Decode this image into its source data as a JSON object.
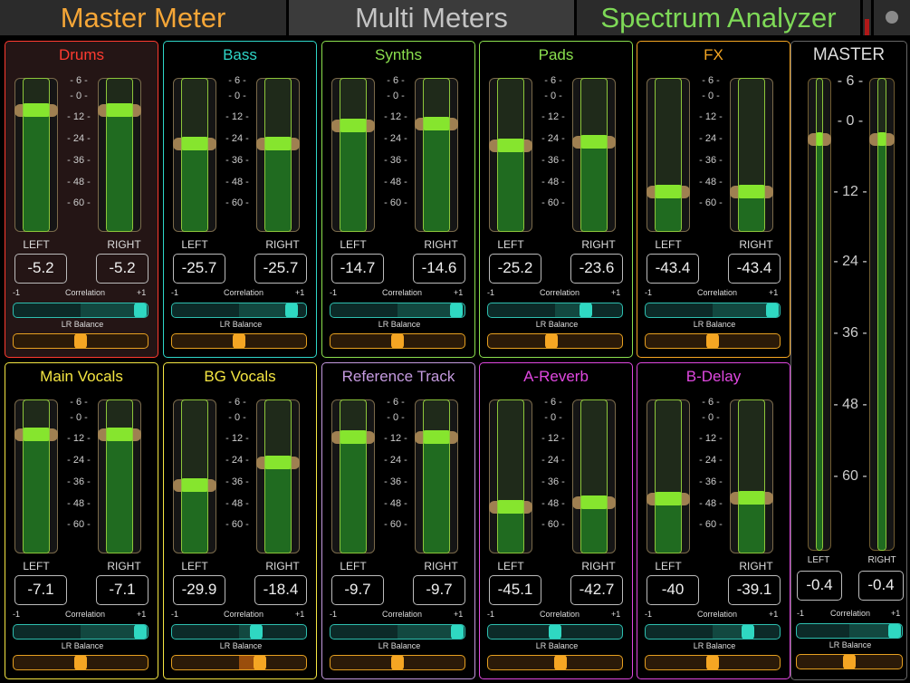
{
  "tabs": {
    "master": {
      "label": "Master Meter",
      "color": "#f5a637"
    },
    "multi": {
      "label": "Multi Meters",
      "color": "#c4c4c4"
    },
    "spectrum": {
      "label": "Spectrum Analyzer",
      "color": "#7ed957"
    }
  },
  "common": {
    "left_label": "LEFT",
    "right_label": "RIGHT",
    "correlation_label": "Correlation",
    "correlation_min": "-1",
    "correlation_max": "+1",
    "balance_label": "LR Balance"
  },
  "scale_ticks": [
    "- 6 -",
    "- 0 -",
    "- 12 -",
    "- 24 -",
    "- 36 -",
    "- 48 -",
    "- 60 -"
  ],
  "channels": [
    {
      "name": "Drums",
      "color": "#ff3b30",
      "bg": "#241515",
      "left_value": "-5.2",
      "right_value": "-5.2",
      "left_level": 0.82,
      "right_level": 0.82,
      "correlation": 1.0,
      "balance": 0.0
    },
    {
      "name": "Bass",
      "color": "#2ed6c8",
      "bg": "#000000",
      "left_value": "-25.7",
      "right_value": "-25.7",
      "left_level": 0.6,
      "right_level": 0.6,
      "correlation": 0.88,
      "balance": 0.0
    },
    {
      "name": "Synths",
      "color": "#8be04e",
      "bg": "#000000",
      "left_value": "-14.7",
      "right_value": "-14.6",
      "left_level": 0.72,
      "right_level": 0.73,
      "correlation": 0.98,
      "balance": 0.0
    },
    {
      "name": "Pads",
      "color": "#8be04e",
      "bg": "#000000",
      "left_value": "-25.2",
      "right_value": "-23.6",
      "left_level": 0.59,
      "right_level": 0.61,
      "correlation": 0.52,
      "balance": -0.05
    },
    {
      "name": "FX",
      "color": "#f5a623",
      "bg": "#000000",
      "left_value": "-43.4",
      "right_value": "-43.4",
      "left_level": 0.29,
      "right_level": 0.29,
      "correlation": 1.0,
      "balance": 0.0
    },
    {
      "name": "Main Vocals",
      "color": "#f5e642",
      "bg": "#000000",
      "left_value": "-7.1",
      "right_value": "-7.1",
      "left_level": 0.8,
      "right_level": 0.8,
      "correlation": 1.0,
      "balance": 0.0
    },
    {
      "name": "BG Vocals",
      "color": "#f5e642",
      "bg": "#000000",
      "left_value": "-29.9",
      "right_value": "-18.4",
      "left_level": 0.47,
      "right_level": 0.62,
      "correlation": 0.3,
      "balance": 0.35
    },
    {
      "name": "Reference Track",
      "color": "#c49adf",
      "bg": "#000000",
      "left_value": "-9.7",
      "right_value": "-9.7",
      "left_level": 0.78,
      "right_level": 0.78,
      "correlation": 1.0,
      "balance": 0.0
    },
    {
      "name": "A-Reverb",
      "color": "#e048e0",
      "bg": "#000000",
      "left_value": "-45.1",
      "right_value": "-42.7",
      "left_level": 0.33,
      "right_level": 0.36,
      "correlation": 0.0,
      "balance": 0.1
    },
    {
      "name": "B-Delay",
      "color": "#e048e0",
      "bg": "#000000",
      "left_value": "-40",
      "right_value": "-39.1",
      "left_level": 0.38,
      "right_level": 0.39,
      "correlation": 0.6,
      "balance": 0.0
    }
  ],
  "master": {
    "name": "MASTER",
    "color": "#dddddd",
    "ticks": [
      "- 6 -",
      "- 0 -",
      "- 12 -",
      "- 24 -",
      "- 36 -",
      "- 48 -",
      "- 60 -"
    ],
    "left_value": "-0.4",
    "right_value": "-0.4",
    "left_level": 0.88,
    "right_level": 0.88,
    "correlation": 1.0,
    "balance": 0.0
  }
}
